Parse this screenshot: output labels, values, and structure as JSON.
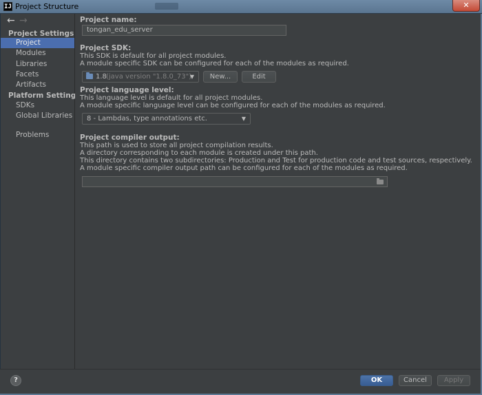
{
  "window": {
    "title": "Project Structure",
    "app_icon_letter": "IJ",
    "close_glyph": "✕"
  },
  "sidebar": {
    "nav": {
      "back": "←",
      "forward": "→"
    },
    "sections": [
      {
        "header": "Project Settings",
        "items": [
          "Project",
          "Modules",
          "Libraries",
          "Facets",
          "Artifacts"
        ]
      },
      {
        "header": "Platform Settings",
        "items": [
          "SDKs",
          "Global Libraries"
        ]
      }
    ],
    "problems": "Problems",
    "selected": "Project"
  },
  "content": {
    "project_name": {
      "label": "Project name:",
      "value": "tongan_edu_server"
    },
    "project_sdk": {
      "label": "Project SDK:",
      "desc1": "This SDK is default for all project modules.",
      "desc2": "A module specific SDK can be configured for each of the modules as required.",
      "selected_name": "1.8",
      "selected_detail": "(java version \"1.8.0_73\")",
      "new_button": "New...",
      "edit_button": "Edit"
    },
    "language_level": {
      "label": "Project language level:",
      "desc1": "This language level is default for all project modules.",
      "desc2": "A module specific language level can be configured for each of the modules as required.",
      "selected": "8 - Lambdas, type annotations etc."
    },
    "compiler_output": {
      "label": "Project compiler output:",
      "desc1": "This path is used to store all project compilation results.",
      "desc2": "A directory corresponding to each module is created under this path.",
      "desc3": "This directory contains two subdirectories: Production and Test for production code and test sources, respectively.",
      "desc4": "A module specific compiler output path can be configured for each of the modules as required.",
      "value": "",
      "browse_icon": "folder-icon"
    }
  },
  "footer": {
    "help": "?",
    "ok": "OK",
    "cancel": "Cancel",
    "apply": "Apply"
  },
  "colors": {
    "background": "#3c3f41",
    "selection": "#4b6eaf",
    "primary_button": "#385d93",
    "text": "#bbbbbb"
  }
}
